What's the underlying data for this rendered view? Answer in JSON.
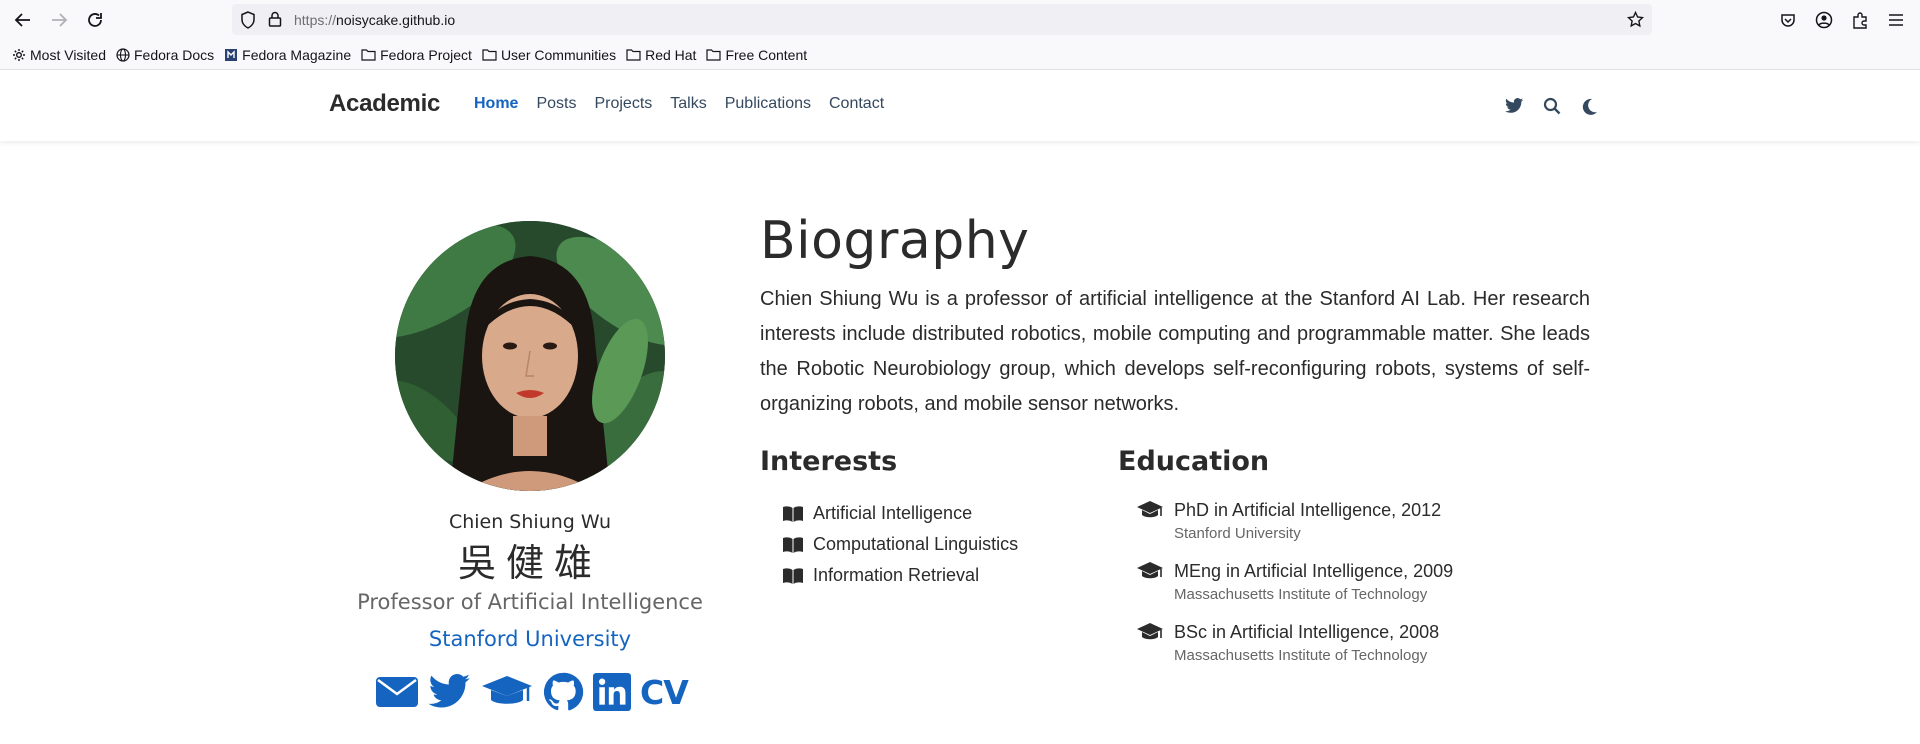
{
  "browser": {
    "url_scheme": "https://",
    "url_host": "noisycake.github.io"
  },
  "bookmarks": [
    {
      "label": "Most Visited",
      "icon": "gear-icon"
    },
    {
      "label": "Fedora Docs",
      "icon": "globe-icon"
    },
    {
      "label": "Fedora Magazine",
      "icon": "fedora-magazine-icon"
    },
    {
      "label": "Fedora Project",
      "icon": "folder-icon"
    },
    {
      "label": "User Communities",
      "icon": "folder-icon"
    },
    {
      "label": "Red Hat",
      "icon": "folder-icon"
    },
    {
      "label": "Free Content",
      "icon": "folder-icon"
    }
  ],
  "site": {
    "brand": "Academic",
    "menu": [
      "Home",
      "Posts",
      "Projects",
      "Talks",
      "Publications",
      "Contact"
    ],
    "active_menu": "Home",
    "accent_color": "#1565c0"
  },
  "profile": {
    "name": "Chien Shiung Wu",
    "name_cn": "吳健雄",
    "role": "Professor of Artificial Intelligence",
    "organization": "Stanford University",
    "cv_label": "CV"
  },
  "biography": {
    "title": "Biography",
    "text": "Chien Shiung Wu is a professor of artificial intelligence at the Stanford AI Lab. Her research interests include distributed robotics, mobile computing and programmable matter. She leads the Robotic Neurobiology group, which develops self-reconfiguring robots, systems of self-organizing robots, and mobile sensor networks."
  },
  "interests": {
    "title": "Interests",
    "items": [
      "Artificial Intelligence",
      "Computational Linguistics",
      "Information Retrieval"
    ]
  },
  "education": {
    "title": "Education",
    "items": [
      {
        "degree": "PhD in Artificial Intelligence, 2012",
        "institution": "Stanford University"
      },
      {
        "degree": "MEng in Artificial Intelligence, 2009",
        "institution": "Massachusetts Institute of Technology"
      },
      {
        "degree": "BSc in Artificial Intelligence, 2008",
        "institution": "Massachusetts Institute of Technology"
      }
    ]
  }
}
